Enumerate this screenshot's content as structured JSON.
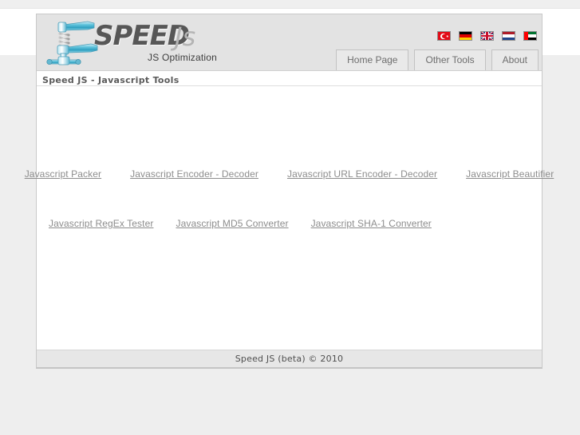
{
  "site": {
    "logo_primary": "SPEED",
    "logo_secondary": "Js",
    "logo_tagline": "JS Optimization",
    "logo_icon": "valve-pipe-icon"
  },
  "languages": [
    {
      "code": "tr",
      "name": "Turkish",
      "icon": "flag-tr-icon"
    },
    {
      "code": "de",
      "name": "German",
      "icon": "flag-de-icon"
    },
    {
      "code": "gb",
      "name": "English",
      "icon": "flag-gb-icon"
    },
    {
      "code": "nl",
      "name": "Dutch",
      "icon": "flag-nl-icon"
    },
    {
      "code": "ae",
      "name": "Arabic",
      "icon": "flag-ae-icon"
    }
  ],
  "nav": {
    "items": [
      {
        "label": "Home Page"
      },
      {
        "label": "Other Tools"
      },
      {
        "label": "About"
      }
    ]
  },
  "page_title": "Speed JS - Javascript Tools",
  "tools": {
    "row1": [
      {
        "label": "Javascript Packer"
      },
      {
        "label": "Javascript Encoder - Decoder"
      },
      {
        "label": "Javascript URL Encoder - Decoder"
      },
      {
        "label": "Javascript Beautifier"
      }
    ],
    "row2": [
      {
        "label": "Javascript RegEx Tester"
      },
      {
        "label": "Javascript MD5 Converter"
      },
      {
        "label": "Javascript SHA-1 Converter"
      }
    ]
  },
  "footer": {
    "text": "Speed JS (beta) © 2010"
  },
  "colors": {
    "header_bg": "#e3e3e3",
    "page_bg": "#eeeeee",
    "link": "#8d8d8d",
    "footer_bg": "#e7e7e7"
  }
}
